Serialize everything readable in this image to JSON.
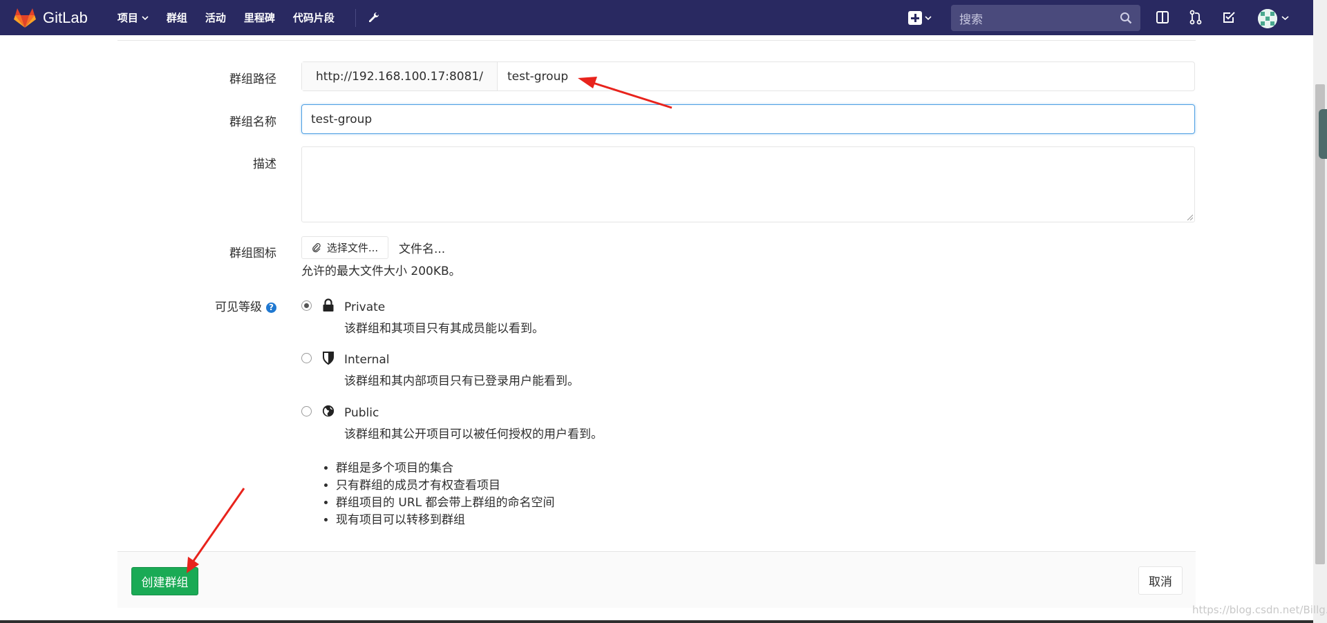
{
  "navbar": {
    "brand": "GitLab",
    "links": [
      {
        "label": "项目",
        "has_dropdown": true
      },
      {
        "label": "群组",
        "has_dropdown": false
      },
      {
        "label": "活动",
        "has_dropdown": false
      },
      {
        "label": "里程碑",
        "has_dropdown": false
      },
      {
        "label": "代码片段",
        "has_dropdown": false
      }
    ],
    "search_placeholder": "搜索",
    "icons": [
      "plus-icon",
      "search-icon",
      "sidebar-toggle-icon",
      "merge-request-icon",
      "todo-icon",
      "avatar"
    ]
  },
  "form": {
    "path_label": "群组路径",
    "path_prefix": "http://192.168.100.17:8081/",
    "path_value": "test-group",
    "name_label": "群组名称",
    "name_value": "test-group",
    "description_label": "描述",
    "avatar_label": "群组图标",
    "choose_file": "选择文件...",
    "file_name": "文件名...",
    "file_hint": "允许的最大文件大小 200KB。",
    "visibility_label": "可见等级",
    "visibility_help": "?",
    "visibility_options": [
      {
        "title": "Private",
        "desc": "该群组和其项目只有其成员能以看到。",
        "checked": true,
        "icon": "lock-icon"
      },
      {
        "title": "Internal",
        "desc": "该群组和其内部项目只有已登录用户能看到。",
        "checked": false,
        "icon": "shield-icon"
      },
      {
        "title": "Public",
        "desc": "该群组和其公开项目可以被任何授权的用户看到。",
        "checked": false,
        "icon": "globe-icon"
      }
    ],
    "notes": [
      "群组是多个项目的集合",
      "只有群组的成员才有权查看项目",
      "群组项目的 URL 都会带上群组的命名空间",
      "现有项目可以转移到群组"
    ]
  },
  "actions": {
    "create": "创建群组",
    "cancel": "取消"
  },
  "watermark": "https://blog.csdn.net/Billg...",
  "colors": {
    "navbar": "#292961",
    "primary_green": "#1aaa55",
    "annotation_arrow": "#e8231c",
    "focus_blue": "#4e9fe3"
  }
}
